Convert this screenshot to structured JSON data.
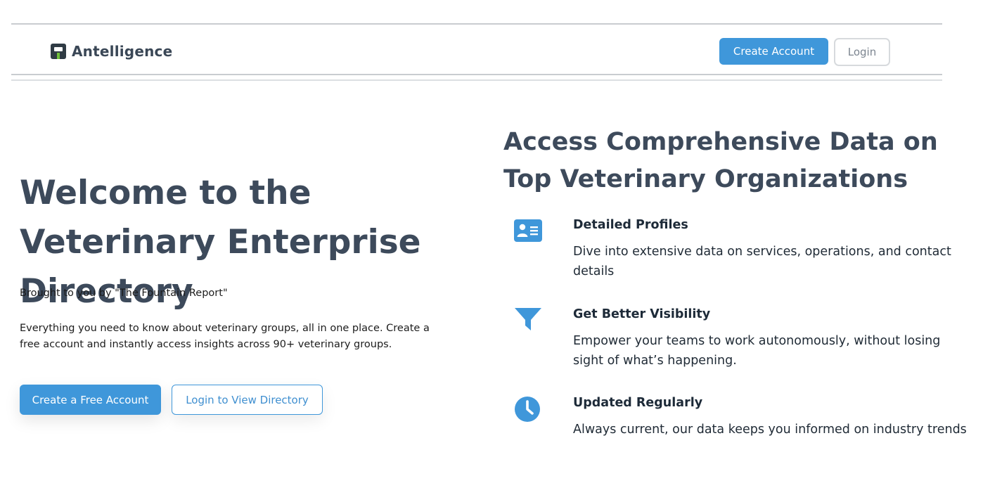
{
  "header": {
    "brand": "Antelligence",
    "create_account": "Create Account",
    "login": "Login"
  },
  "hero": {
    "title": "Welcome to the Veterinary Enterprise Directory",
    "brought_by": "Brought to you by \"The Fountain Report\"",
    "description": "Everything you need to know about veterinary groups, all in one place. Create a free account and instantly access insights across 90+ veterinary groups.",
    "primary_cta": "Create a Free Account",
    "secondary_cta": "Login to View Directory"
  },
  "features": {
    "title": "Access Comprehensive Data on Top Veterinary Organizations",
    "items": [
      {
        "icon": "id-card-icon",
        "title": "Detailed Profiles",
        "description": "Dive into extensive data on services, operations, and contact details"
      },
      {
        "icon": "funnel-icon",
        "title": "Get Better Visibility",
        "description": "Empower your teams to work autonomously, without losing sight of what’s happening."
      },
      {
        "icon": "clock-icon",
        "title": "Updated Regularly",
        "description": "Always current, our data keeps you informed on industry trends"
      }
    ]
  },
  "colors": {
    "accent": "#3f97da",
    "heading": "#3d4a5b"
  }
}
